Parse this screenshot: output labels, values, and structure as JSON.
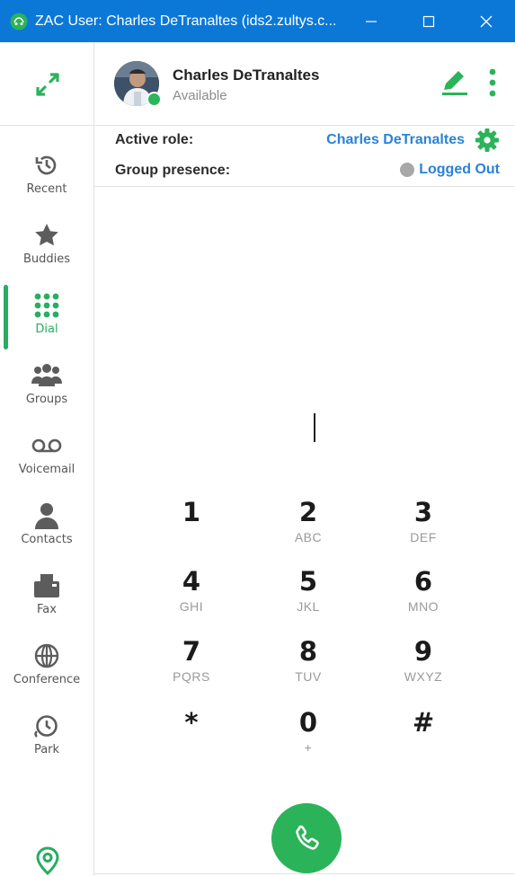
{
  "window": {
    "title": "ZAC User: Charles DeTranaltes (ids2.zultys.c...",
    "minimize_glyph": "—",
    "maximize_glyph": "☐",
    "close_glyph": "✕"
  },
  "sidebar": {
    "items": [
      {
        "label": "Recent",
        "icon": "history-icon"
      },
      {
        "label": "Buddies",
        "icon": "star-icon"
      },
      {
        "label": "Dial",
        "icon": "dialpad-icon",
        "active": true
      },
      {
        "label": "Groups",
        "icon": "group-icon"
      },
      {
        "label": "Voicemail",
        "icon": "voicemail-icon"
      },
      {
        "label": "Contacts",
        "icon": "person-icon"
      },
      {
        "label": "Fax",
        "icon": "fax-icon"
      },
      {
        "label": "Conference",
        "icon": "globe-icon"
      },
      {
        "label": "Park",
        "icon": "park-icon"
      }
    ]
  },
  "profile": {
    "name": "Charles DeTranaltes",
    "status": "Available"
  },
  "role": {
    "label": "Active role:",
    "value": "Charles DeTranaltes"
  },
  "group_presence": {
    "label": "Group presence:",
    "value": "Logged Out"
  },
  "dialer": {
    "number": "",
    "keys": [
      {
        "digit": "1",
        "letters": ""
      },
      {
        "digit": "2",
        "letters": "ABC"
      },
      {
        "digit": "3",
        "letters": "DEF"
      },
      {
        "digit": "4",
        "letters": "GHI"
      },
      {
        "digit": "5",
        "letters": "JKL"
      },
      {
        "digit": "6",
        "letters": "MNO"
      },
      {
        "digit": "7",
        "letters": "PQRS"
      },
      {
        "digit": "8",
        "letters": "TUV"
      },
      {
        "digit": "9",
        "letters": "WXYZ"
      },
      {
        "digit": "*",
        "letters": ""
      },
      {
        "digit": "0",
        "letters": "+"
      },
      {
        "digit": "#",
        "letters": ""
      }
    ]
  },
  "colors": {
    "titlebar": "#0b78d7",
    "accent_green": "#27ae60",
    "link_blue": "#2a82d6",
    "presence_available": "#2bb55c",
    "presence_logged_out": "#a8a8a8"
  }
}
